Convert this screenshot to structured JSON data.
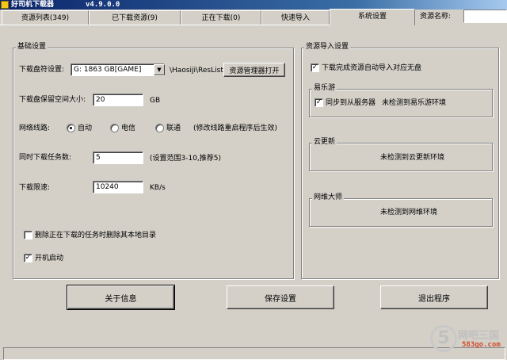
{
  "window": {
    "title": "好司机下载器",
    "version": "v4.9.0.0"
  },
  "tabs": [
    {
      "label": "资源列表(349)"
    },
    {
      "label": "已下载资源(9)"
    },
    {
      "label": "正在下载(0)"
    },
    {
      "label": "快速导入"
    },
    {
      "label": "系统设置"
    }
  ],
  "active_tab": "系统设置",
  "search": {
    "label": "资源名称:",
    "value": ""
  },
  "basic": {
    "title": "基础设置",
    "drive_label": "下载盘符设置:",
    "drive_value": "G: 1863 GB[GAME]",
    "path_text": "\\Haosiji\\ResList",
    "open_manager_button": "资源管理器打开",
    "reserve_label": "下载盘保留空间大小:",
    "reserve_value": "20",
    "reserve_unit": "GB",
    "line_label": "网络线路:",
    "line_options": [
      "自动",
      "电信",
      "联通"
    ],
    "line_selected": "自动",
    "line_note": "(修改线路重启程序后生效)",
    "tasks_label": "同时下载任务数:",
    "tasks_value": "5",
    "tasks_note": "(设置范围3-10,推荐5)",
    "speed_label": "下载限速:",
    "speed_value": "10240",
    "speed_unit": "KB/s",
    "delete_label": "删除正在下载的任务时删除其本地目录",
    "delete_checked": false,
    "startup_label": "开机启动",
    "startup_checked": true
  },
  "import": {
    "title": "资源导入设置",
    "auto_import_label": "下载完成资源自动导入对应无盘",
    "auto_import_checked": true,
    "yileyou": {
      "title": "易乐游",
      "sync_label": "同步到从服务器",
      "sync_checked": true,
      "status": "未检测到易乐游环境"
    },
    "yungengxin": {
      "title": "云更新",
      "status": "未检测到云更新环境"
    },
    "wangwei": {
      "title": "网维大师",
      "status": "未检测到网维环境"
    }
  },
  "footer": {
    "about_button": "关于信息",
    "save_button": "保存设置",
    "exit_button": "退出程序"
  },
  "watermark": {
    "glyph": "5",
    "text": "网吧三国",
    "url": "583go.com"
  }
}
